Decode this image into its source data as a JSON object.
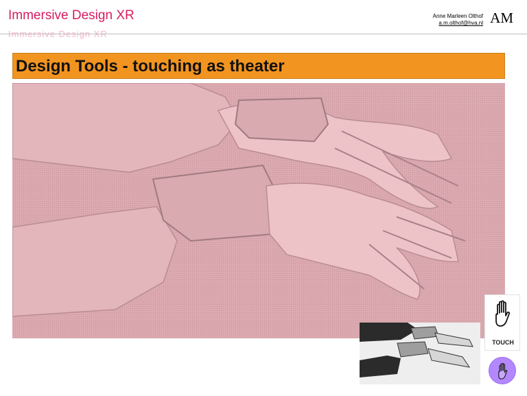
{
  "header": {
    "course_title": "Immersive Design XR",
    "course_title_ghost": "Immersive Design XR",
    "author_name": "Anne Marleen Olthof",
    "author_email": "a.m.olthof@hva.nl",
    "monogram": "AM"
  },
  "slide": {
    "title": "Design Tools - touching as theater",
    "title_bar_color": "#f29420"
  },
  "images": {
    "main": "embossed-hands-on-pink",
    "thumbnail": "grayscale-hands-sketch"
  },
  "touch": {
    "icon": "hand-icon",
    "label": "TOUCH",
    "circle_color": "#b388ff"
  }
}
